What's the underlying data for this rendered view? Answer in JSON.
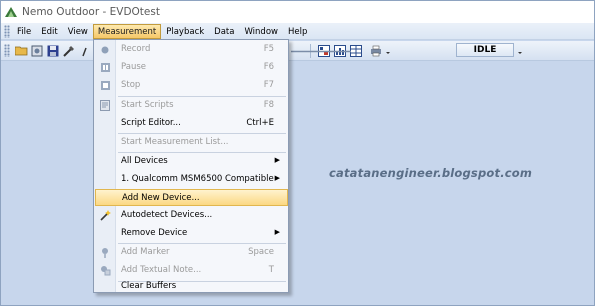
{
  "window": {
    "title": "Nemo Outdoor - EVDOtest"
  },
  "menubar": {
    "items": [
      "File",
      "Edit",
      "View",
      "Measurement",
      "Playback",
      "Data",
      "Window",
      "Help"
    ],
    "active": "Measurement"
  },
  "toolbar": {
    "status": "IDLE"
  },
  "watermark": "catatanengineer.blogspot.com",
  "measurement_menu": {
    "items": [
      {
        "label": "Record",
        "shortcut": "F5",
        "enabled": false,
        "icon": "record-icon"
      },
      {
        "label": "Pause",
        "shortcut": "F6",
        "enabled": false,
        "icon": "pause-icon"
      },
      {
        "label": "Stop",
        "shortcut": "F7",
        "enabled": false,
        "icon": "stop-icon"
      },
      {
        "label": "Start Scripts",
        "shortcut": "F8",
        "enabled": false,
        "icon": "script-icon"
      },
      {
        "label": "Script Editor...",
        "shortcut": "Ctrl+E",
        "enabled": true
      },
      {
        "label": "Start Measurement List...",
        "shortcut": "",
        "enabled": false
      },
      {
        "label": "All Devices",
        "submenu": true,
        "enabled": true
      },
      {
        "label": "1. Qualcomm MSM6500 Compatible",
        "submenu": true,
        "enabled": true
      },
      {
        "label": "Add New Device...",
        "enabled": true,
        "highlighted": true
      },
      {
        "label": "Autodetect Devices...",
        "enabled": true,
        "icon": "wand-icon"
      },
      {
        "label": "Remove Device",
        "submenu": true,
        "enabled": true
      },
      {
        "label": "Add Marker",
        "shortcut": "Space",
        "enabled": false,
        "icon": "marker-icon"
      },
      {
        "label": "Add Textual Note...",
        "shortcut": "T",
        "enabled": false,
        "icon": "note-icon"
      },
      {
        "label": "Clear Buffers",
        "enabled": true
      }
    ]
  }
}
